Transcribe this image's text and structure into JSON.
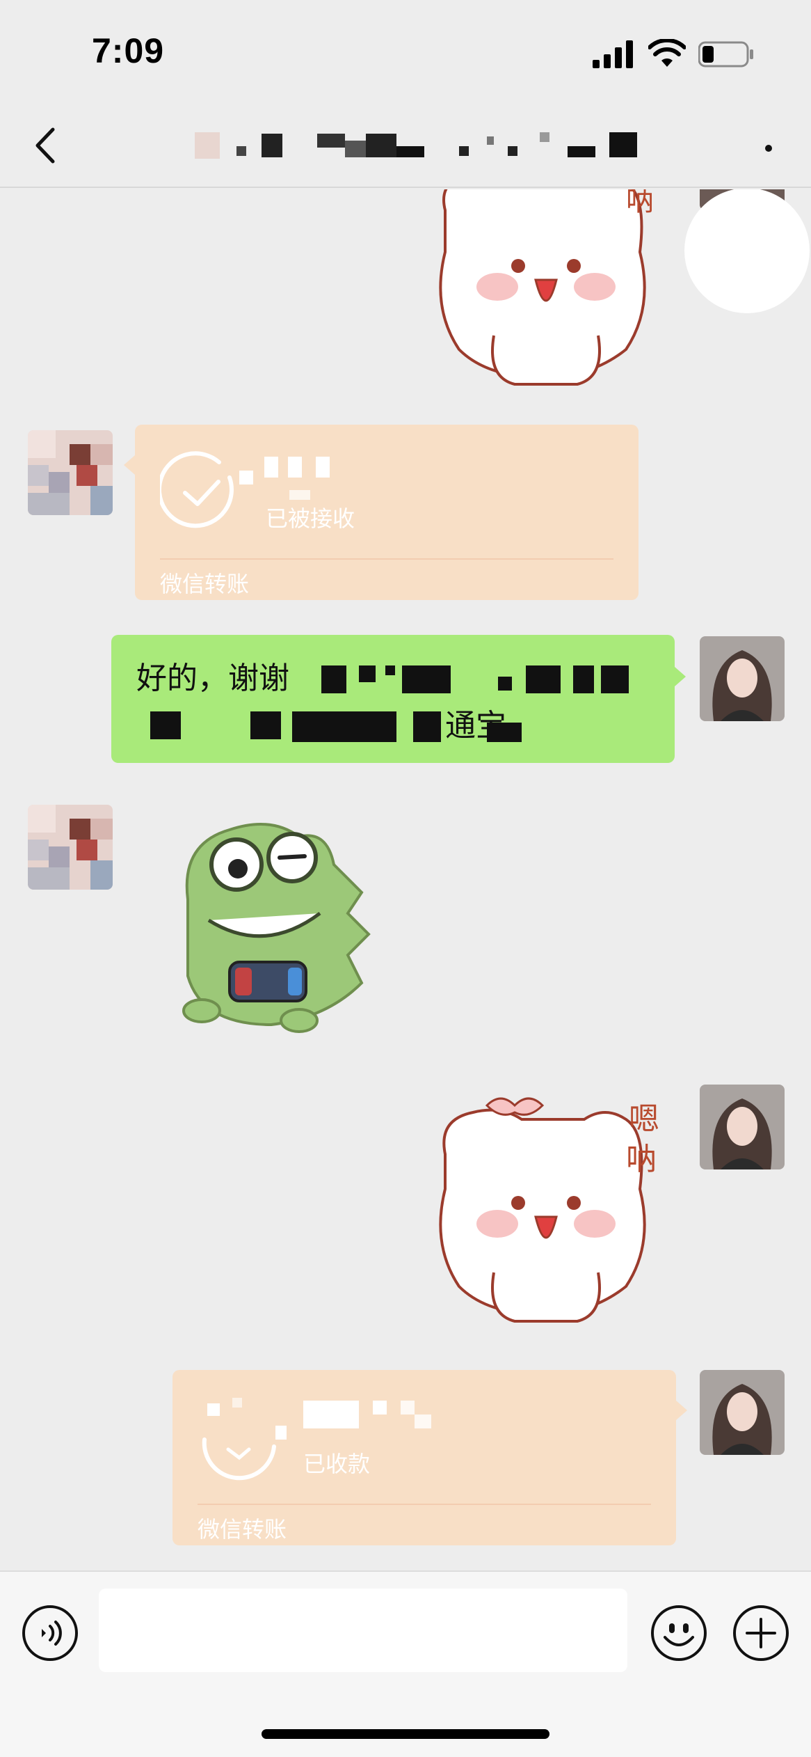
{
  "status_bar": {
    "time": "7:09",
    "icons": [
      "signal-icon",
      "wifi-icon",
      "battery-icon"
    ]
  },
  "header": {
    "back_icon": "chevron-left-icon",
    "more_icon": "more-icon"
  },
  "messages": [
    {
      "type": "sticker",
      "from": "me",
      "sticker": "white-bunny-sticker",
      "caption": "呐"
    },
    {
      "type": "transfer",
      "from": "contact",
      "status": "已被接收",
      "footer": "微信转账",
      "icon": "check-circle-icon"
    },
    {
      "type": "text",
      "from": "me",
      "line1_visible": "好的，谢谢",
      "line2_visible": "通宝"
    },
    {
      "type": "sticker",
      "from": "contact",
      "sticker": "green-frog-sticker"
    },
    {
      "type": "sticker",
      "from": "me",
      "sticker": "white-bunny-sticker",
      "caption_line1": "嗯",
      "caption_line2": "呐"
    },
    {
      "type": "transfer",
      "from": "me",
      "status": "已收款",
      "footer": "微信转账",
      "icon": "transfer-arrow-icon"
    }
  ],
  "input_bar": {
    "placeholder": "",
    "voice_icon": "voice-icon",
    "emoji_icon": "emoji-icon",
    "plus_icon": "plus-icon"
  },
  "colors": {
    "background": "#ededed",
    "my_bubble": "#a9ea7a",
    "transfer_card": "#f8dfc6",
    "sticker_outline": "#9b3b2c"
  }
}
